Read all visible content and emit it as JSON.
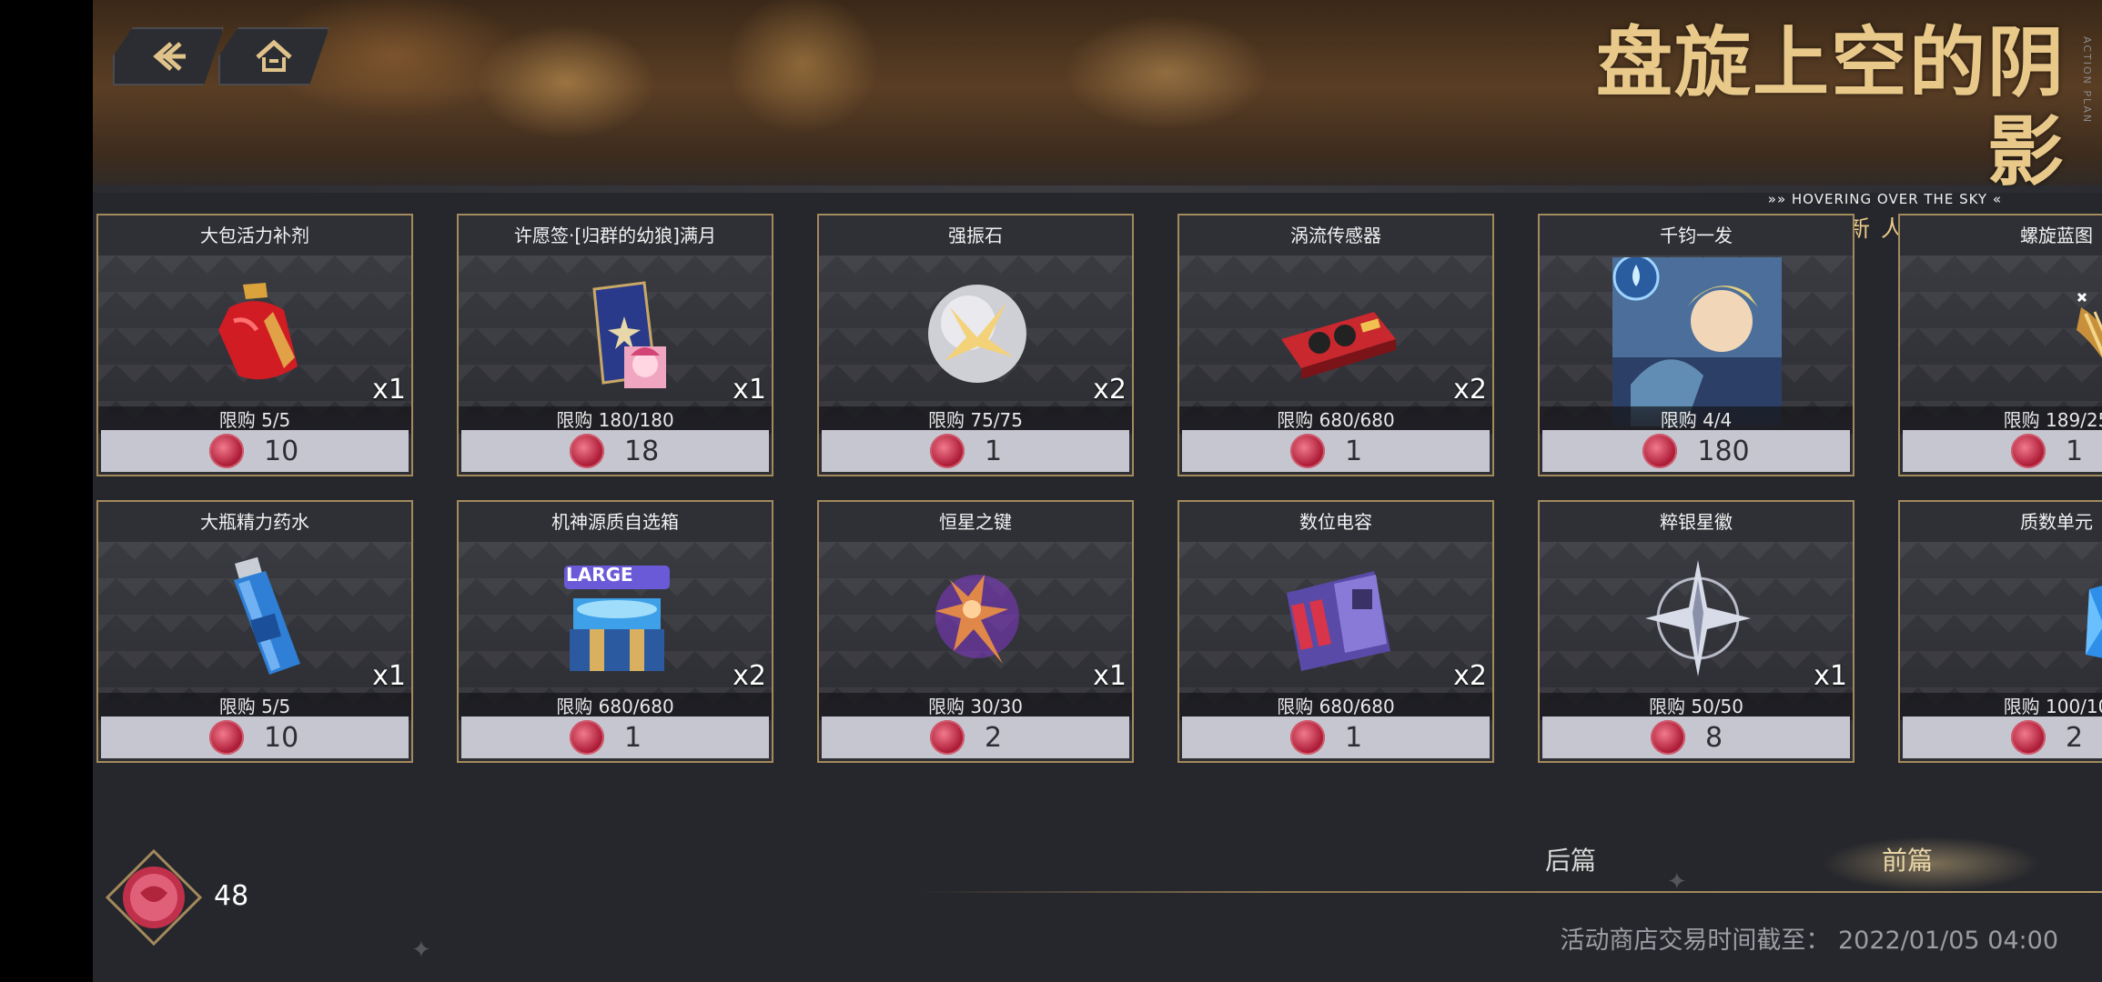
{
  "header": {
    "back_label": "back",
    "home_label": "home",
    "logo_title": "盘旋上空的阴影",
    "logo_english": "»» HOVERING OVER THE SKY «",
    "logo_subtitle": "艾尼亚德新人大冒险",
    "logo_side": "ACTION PLAN"
  },
  "shop": {
    "row1": [
      {
        "name": "大包活力补剂",
        "qty": "x1",
        "limit": "限购 5/5",
        "price": "10",
        "icon": "red-pouch-icon"
      },
      {
        "name": "许愿签·[归群的幼狼]满月",
        "qty": "x1",
        "limit": "限购 180/180",
        "price": "18",
        "icon": "wish-card-icon"
      },
      {
        "name": "强振石",
        "qty": "x2",
        "limit": "限购 75/75",
        "price": "1",
        "icon": "crystal-orb-icon"
      },
      {
        "name": "涡流传感器",
        "qty": "x2",
        "limit": "限购 680/680",
        "price": "1",
        "icon": "sensor-device-icon"
      },
      {
        "name": "千钧一发",
        "qty": "",
        "limit": "限购 4/4",
        "price": "180",
        "icon": "character-portrait-icon"
      },
      {
        "name": "螺旋蓝图",
        "qty": "",
        "limit": "限购 189/25",
        "price": "1",
        "icon": "spiral-blueprint-icon"
      }
    ],
    "row2": [
      {
        "name": "大瓶精力药水",
        "qty": "x1",
        "limit": "限购 5/5",
        "price": "10",
        "icon": "blue-bottle-icon"
      },
      {
        "name": "机神源质自选箱",
        "qty": "x2",
        "limit": "限购 680/680",
        "price": "1",
        "icon": "large-chest-icon"
      },
      {
        "name": "恒星之键",
        "qty": "x1",
        "limit": "限购 30/30",
        "price": "2",
        "icon": "star-key-icon"
      },
      {
        "name": "数位电容",
        "qty": "x2",
        "limit": "限购 680/680",
        "price": "1",
        "icon": "capacitor-icon"
      },
      {
        "name": "粹银星徽",
        "qty": "x1",
        "limit": "限购 50/50",
        "price": "8",
        "icon": "silver-star-icon"
      },
      {
        "name": "质数单元",
        "qty": "",
        "limit": "限购 100/10",
        "price": "2",
        "icon": "prime-cube-icon"
      }
    ],
    "large_tag": "LARGE"
  },
  "footer": {
    "currency_amount": "48",
    "tab_later": "后篇",
    "tab_earlier": "前篇",
    "deadline": "活动商店交易时间截至： 2022/01/05 04:00"
  },
  "colors": {
    "gold_border": "#a38a5c",
    "price_bar": "#c5c6d0",
    "coin": "#b01f3a"
  }
}
